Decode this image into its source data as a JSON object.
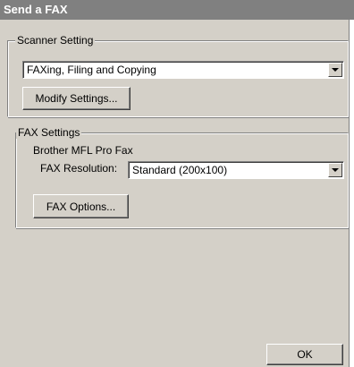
{
  "window": {
    "title": "Send a FAX"
  },
  "scanner_setting": {
    "legend": "Scanner Setting",
    "selected": "FAXing, Filing and Copying",
    "modify_button": "Modify Settings..."
  },
  "fax_settings": {
    "legend": "FAX Settings",
    "device": "Brother MFL Pro Fax",
    "resolution_label": "FAX Resolution:",
    "resolution_selected": "Standard (200x100)",
    "options_button": "FAX Options..."
  },
  "footer": {
    "ok_button": "OK"
  },
  "icons": {
    "dropdown": "chevron-down-icon"
  },
  "colors": {
    "titlebar": "#808080",
    "dialog": "#d4d0c8"
  }
}
